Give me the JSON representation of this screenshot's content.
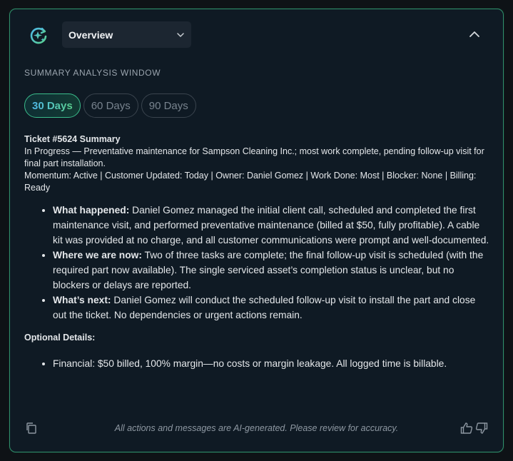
{
  "header": {
    "dropdown_label": "Overview",
    "ai_icon": "ai-sparkle-refresh-icon",
    "chevron_icon": "chevron-down-icon",
    "collapse_icon": "chevron-up-icon"
  },
  "window_label": "SUMMARY ANALYSIS WINDOW",
  "pills": [
    {
      "label": "30 Days",
      "active": true
    },
    {
      "label": "60 Days",
      "active": false
    },
    {
      "label": "90 Days",
      "active": false
    }
  ],
  "summary": {
    "title": "Ticket #5624 Summary",
    "status_line": "In Progress — Preventative maintenance for Sampson Cleaning Inc.; most work complete, pending follow-up visit for final part installation.",
    "meta_line": "Momentum: Active | Customer Updated: Today | Owner: Daniel Gomez | Work Done: Most | Blocker: None | Billing: Ready",
    "bullets": [
      {
        "label": "What happened:",
        "text": " Daniel Gomez managed the initial client call, scheduled and completed the first maintenance visit, and performed preventative maintenance (billed at $50, fully profitable). A cable kit was provided at no charge, and all customer communications were prompt and well-documented."
      },
      {
        "label": "Where we are now:",
        "text": " Two of three tasks are complete; the final follow-up visit is scheduled (with the required part now available). The single serviced asset’s completion status is unclear, but no blockers or delays are reported."
      },
      {
        "label": "What’s next:",
        "text": " Daniel Gomez will conduct the scheduled follow-up visit to install the part and close out the ticket. No dependencies or urgent actions remain."
      }
    ],
    "optional_title": "Optional Details:",
    "optional_items": [
      "Financial: $50 billed, 100% margin—no costs or margin leakage. All logged time is billable."
    ]
  },
  "footer": {
    "disclaimer": "All actions and messages are AI-generated. Please review for accuracy.",
    "copy_icon": "copy-icon",
    "thumb_up_icon": "thumbs-up-icon",
    "thumb_down_icon": "thumbs-down-icon"
  },
  "colors": {
    "accent_green": "#3bbd8c",
    "accent_blue": "#4fb8e8",
    "panel_bg": "#0f1a24"
  }
}
